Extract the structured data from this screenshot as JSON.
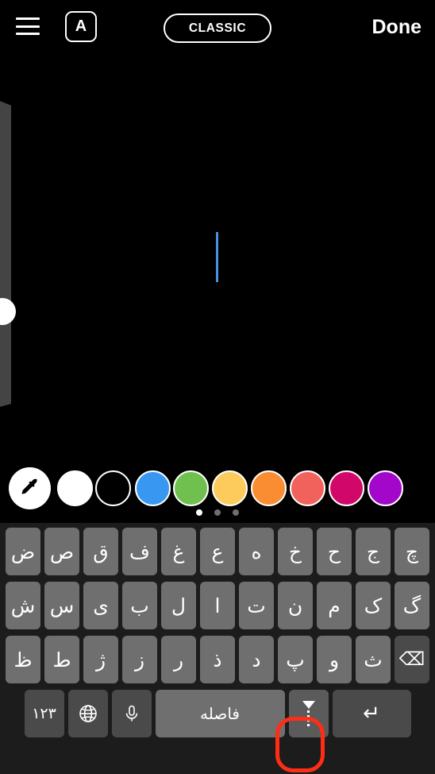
{
  "app": {
    "name": "story-text-editor",
    "background_color": "#000000"
  },
  "topbar": {
    "align_icon": "text-align-icon",
    "text_style_label": "A",
    "font_label": "CLASSIC",
    "done_label": "Done"
  },
  "canvas": {
    "caret_color": "#4a90e2",
    "text_value": ""
  },
  "size_slider": {
    "name": "text-size-slider",
    "handle_position_percent": 65,
    "track_color": "#6d6d6d",
    "handle_color": "#ffffff"
  },
  "palette": {
    "eyedropper_label": "eyedropper-icon",
    "swatches": [
      {
        "name": "white",
        "color": "#ffffff"
      },
      {
        "name": "black",
        "color": "#000000"
      },
      {
        "name": "blue",
        "color": "#3897f0"
      },
      {
        "name": "green",
        "color": "#70c050"
      },
      {
        "name": "yellow",
        "color": "#fdcb5c"
      },
      {
        "name": "orange",
        "color": "#fa8d32"
      },
      {
        "name": "red",
        "color": "#f2625c"
      },
      {
        "name": "pink",
        "color": "#d10869"
      },
      {
        "name": "purple",
        "color": "#a307c9"
      }
    ],
    "page_dots": {
      "total": 3,
      "active_index": 0
    }
  },
  "keyboard": {
    "language": "fa",
    "background_color": "#1c1c1c",
    "key_color": "#6f6f6f",
    "fn_key_color": "#4a4a4a",
    "rows": [
      [
        "ض",
        "ص",
        "ق",
        "ف",
        "غ",
        "ع",
        "ه",
        "خ",
        "ح",
        "ج",
        "چ"
      ],
      [
        "ش",
        "س",
        "ی",
        "ب",
        "ل",
        "ا",
        "ت",
        "ن",
        "م",
        "ک",
        "گ"
      ],
      [
        "ظ",
        "ط",
        "ژ",
        "ز",
        "ر",
        "ذ",
        "د",
        "پ",
        "و",
        "ث"
      ]
    ],
    "backspace_label": "⌫",
    "bottom_row": {
      "numbers_label": "۱۲۳",
      "globe_label": "globe-icon",
      "mic_label": "microphone-icon",
      "space_label": "فاصله",
      "hide_keyboard_label": "hide-keyboard-icon",
      "return_label": "↵"
    }
  },
  "highlight": {
    "name": "hide-keyboard-highlight",
    "color": "#ff2d16",
    "target": "hide-keyboard-key"
  }
}
